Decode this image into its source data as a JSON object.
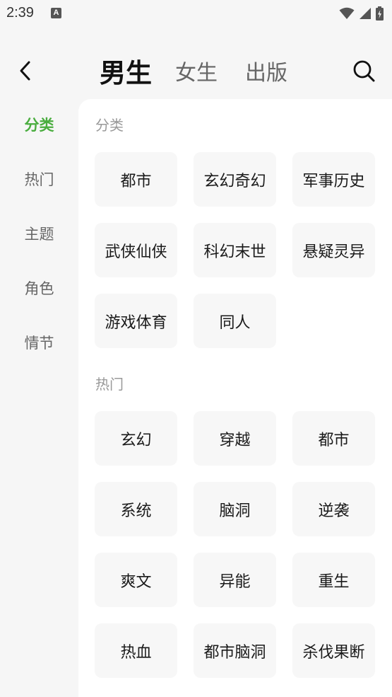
{
  "status": {
    "time": "2:39",
    "app_icon_letter": "A"
  },
  "header": {
    "tabs": [
      "男生",
      "女生",
      "出版"
    ]
  },
  "sidebar": {
    "items": [
      "分类",
      "热门",
      "主题",
      "角色",
      "情节"
    ],
    "active_index": 0
  },
  "sections": [
    {
      "title": "分类",
      "items": [
        "都市",
        "玄幻奇幻",
        "军事历史",
        "武侠仙侠",
        "科幻末世",
        "悬疑灵异",
        "游戏体育",
        "同人"
      ]
    },
    {
      "title": "热门",
      "items": [
        "玄幻",
        "穿越",
        "都市",
        "系统",
        "脑洞",
        "逆袭",
        "爽文",
        "异能",
        "重生",
        "热血",
        "都市脑洞",
        "杀伐果断"
      ]
    }
  ],
  "colors": {
    "accent": "#4aad3f",
    "background": "#f6f6f6",
    "chip": "#f7f7f7"
  },
  "icons": {
    "back": "back-arrow-icon",
    "search": "search-icon",
    "wifi": "wifi-icon",
    "signal": "signal-icon",
    "battery": "battery-icon"
  }
}
